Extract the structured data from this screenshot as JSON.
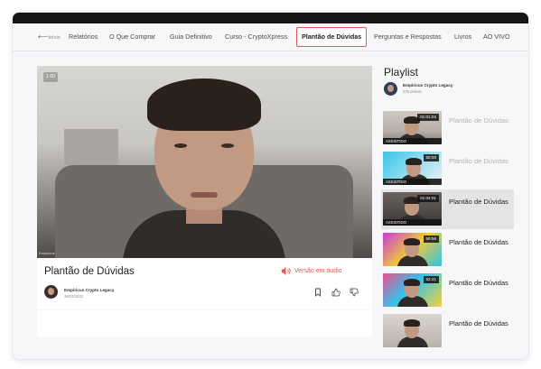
{
  "nav": {
    "back": "Início",
    "items": [
      "Relatórios",
      "O Que Comprar",
      "Guia Definitivo",
      "Curso - CryptoXpress",
      "Plantão de Dúvidas",
      "Perguntas e Respostas",
      "Livros",
      "AO VIVO"
    ],
    "active": "Plantão de Dúvidas"
  },
  "video": {
    "badge": "1.00",
    "watermark": "Empiricus"
  },
  "info": {
    "title": "Plantão de Dúvidas",
    "audio_label": "Versão em áudio",
    "channel_name": "Empiricus Crypto Legacy",
    "date": "28/03/2022"
  },
  "playlist": {
    "title": "Playlist",
    "channel_name": "Empiricus Crypto Legacy",
    "count": "275 vídeos",
    "items": [
      {
        "label": "Plantão de Dúvidas",
        "duration": "01:01:04",
        "watched": "ASSISTIDO"
      },
      {
        "label": "Plantão de Dúvidas",
        "duration": "50:00",
        "watched": "ASSISTIDO"
      },
      {
        "label": "Plantão de Dúvidas",
        "duration": "01:04:01",
        "watched": "ASSISTIDO"
      },
      {
        "label": "Plantão de Dúvidas",
        "duration": "59:56",
        "watched": ""
      },
      {
        "label": "Plantão de Dúvidas",
        "duration": "52:41",
        "watched": ""
      },
      {
        "label": "Plantão de Dúvidas",
        "duration": "",
        "watched": ""
      }
    ]
  },
  "colors": {
    "accent": "#e05a5a",
    "text": "#1e1e1e",
    "muted": "#b5b5b5"
  }
}
